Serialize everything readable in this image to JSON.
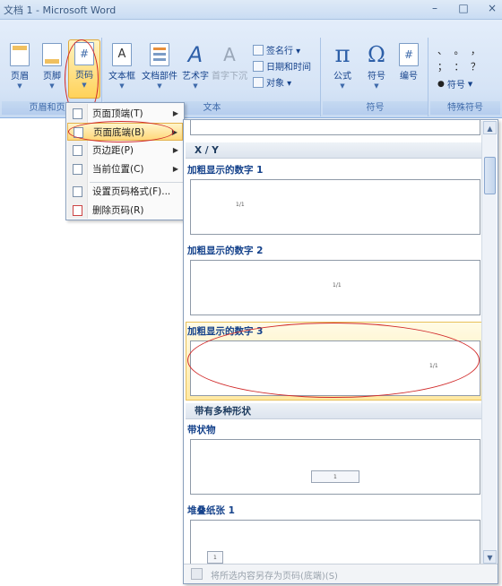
{
  "window": {
    "title": "文档 1 - Microsoft Word",
    "controls": [
      "–",
      "□",
      "×"
    ]
  },
  "ribbon": {
    "group_header_footer": {
      "label": "页眉和页脚",
      "buttons": [
        {
          "label": "页眉",
          "icon": "header-icon"
        },
        {
          "label": "页脚",
          "icon": "footer-icon"
        },
        {
          "label": "页码",
          "icon": "page-number-icon",
          "glyph": "#"
        }
      ]
    },
    "group_text": {
      "label": "文本",
      "buttons": [
        {
          "label": "文本框",
          "icon": "textbox-icon",
          "glyph": "A"
        },
        {
          "label": "文档部件",
          "icon": "quick-parts-icon"
        },
        {
          "label": "艺术字",
          "icon": "wordart-icon",
          "glyph": "A"
        },
        {
          "label": "首字下沉",
          "icon": "dropcap-icon",
          "glyph": "A"
        }
      ],
      "small": [
        {
          "label": "签名行 ▾",
          "icon": "signature-line-icon"
        },
        {
          "label": "日期和时间",
          "icon": "date-time-icon"
        },
        {
          "label": "对象 ▾",
          "icon": "object-icon"
        }
      ]
    },
    "group_symbols": {
      "label": "符号",
      "buttons": [
        {
          "label": "公式",
          "icon": "equation-icon",
          "glyph": "π"
        },
        {
          "label": "符号",
          "icon": "symbol-icon",
          "glyph": "Ω"
        },
        {
          "label": "编号",
          "icon": "numbering-icon",
          "glyph": "#"
        }
      ]
    },
    "group_special": {
      "label": "特殊符号",
      "rows": [
        "、 。 ，",
        "； ： ？"
      ],
      "symbol_button": "符号"
    }
  },
  "menu": {
    "items": [
      {
        "label": "页面顶端(T)",
        "icon": "page-top-icon",
        "submenu": true
      },
      {
        "label": "页面底端(B)",
        "icon": "page-bottom-icon",
        "submenu": true,
        "active": true
      },
      {
        "label": "页边距(P)",
        "icon": "page-margin-icon",
        "submenu": true
      },
      {
        "label": "当前位置(C)",
        "icon": "current-position-icon",
        "submenu": true
      },
      {
        "label": "设置页码格式(F)...",
        "icon": "format-page-numbers-icon",
        "submenu": false
      },
      {
        "label": "删除页码(R)",
        "icon": "remove-page-numbers-icon",
        "submenu": false
      }
    ]
  },
  "gallery": {
    "sections": [
      {
        "title": "X / Y"
      },
      {
        "title": "带有多种形状"
      }
    ],
    "items": [
      {
        "label": "加粗显示的数字 1",
        "page_number": "1/1"
      },
      {
        "label": "加粗显示的数字 2",
        "page_number": "1/1"
      },
      {
        "label": "加粗显示的数字 3",
        "page_number": "1/1",
        "highlighted": true
      },
      {
        "label": "带状物",
        "page_number": "1"
      },
      {
        "label": "堆叠纸张 1",
        "page_number": "1"
      }
    ],
    "footer": "将所选内容另存为页码(底端)(S)"
  },
  "colors": {
    "accent": "#15428b",
    "highlight": "#ffd87a",
    "annotation": "#d12b2b"
  }
}
